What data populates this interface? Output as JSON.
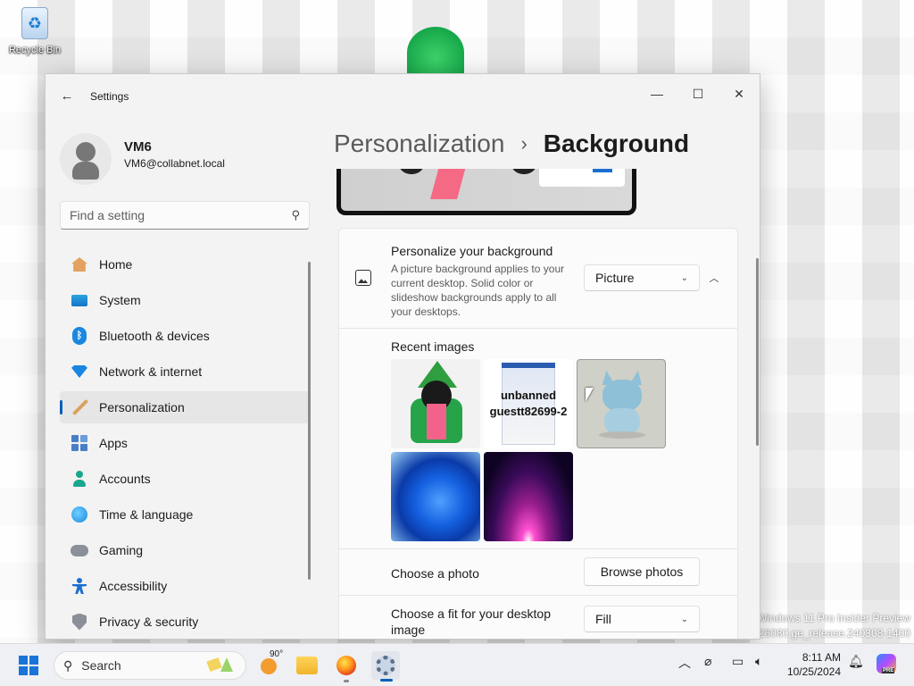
{
  "desktop": {
    "recycle_bin_label": "Recycle Bin",
    "watermark_line1": "Windows 11 Pro Insider Preview",
    "watermark_line2": "ld 26080.ge_release.240308-1400"
  },
  "window": {
    "title": "Settings",
    "back_icon": "back-arrow-icon",
    "controls": {
      "minimize": "—",
      "maximize": "☐",
      "close": "✕"
    }
  },
  "profile": {
    "name": "VM6",
    "email": "VM6@collabnet.local"
  },
  "search": {
    "placeholder": "Find a setting",
    "value": ""
  },
  "sidebar": {
    "items": [
      {
        "label": "Home",
        "icon": "home-icon"
      },
      {
        "label": "System",
        "icon": "system-icon"
      },
      {
        "label": "Bluetooth & devices",
        "icon": "bluetooth-icon"
      },
      {
        "label": "Network & internet",
        "icon": "network-icon"
      },
      {
        "label": "Personalization",
        "icon": "brush-icon",
        "active": true
      },
      {
        "label": "Apps",
        "icon": "apps-icon"
      },
      {
        "label": "Accounts",
        "icon": "accounts-icon"
      },
      {
        "label": "Time & language",
        "icon": "globe-clock-icon"
      },
      {
        "label": "Gaming",
        "icon": "gamepad-icon"
      },
      {
        "label": "Accessibility",
        "icon": "accessibility-icon"
      },
      {
        "label": "Privacy & security",
        "icon": "shield-icon"
      }
    ]
  },
  "breadcrumb": {
    "parent": "Personalization",
    "separator": "›",
    "current": "Background"
  },
  "background_card": {
    "title": "Personalize your background",
    "description": "A picture background applies to your current desktop. Solid color or slideshow backgrounds apply to all your desktops.",
    "type_value": "Picture",
    "recent_label": "Recent images",
    "thumb2_caption_line1": "unbanned",
    "thumb2_caption_line2": "guestt82699-2",
    "choose_photo_label": "Choose a photo",
    "browse_button": "Browse photos",
    "choose_fit_label": "Choose a fit for your desktop image",
    "fit_value": "Fill"
  },
  "taskbar": {
    "search_placeholder": "Search",
    "weather_temp": "90°",
    "time": "8:11 AM",
    "date": "10/25/2024",
    "copilot_badge": "PRE"
  }
}
